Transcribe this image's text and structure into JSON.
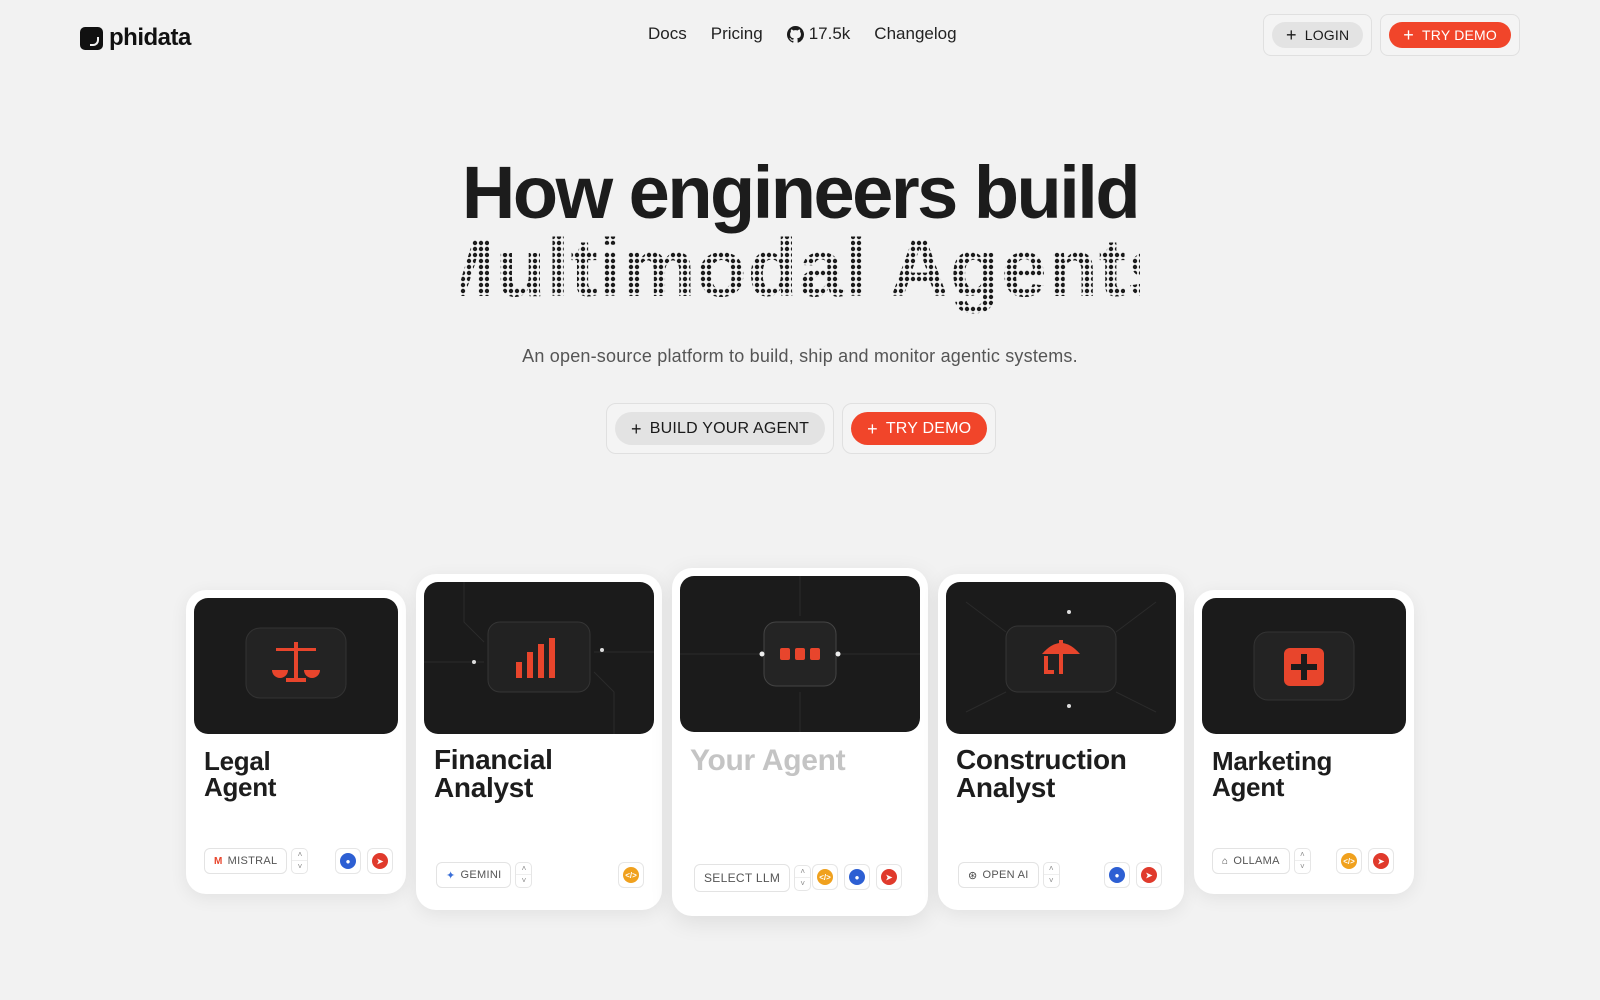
{
  "nav": {
    "logo": "phidata",
    "links": [
      "Docs",
      "Pricing",
      "17.5k",
      "Changelog"
    ],
    "login": "LOGIN",
    "try_demo": "TRY DEMO"
  },
  "hero": {
    "title": "How engineers build",
    "subtitle_dotted": "Multimodal Agents",
    "description": "An open-source platform to build, ship and monitor agentic systems.",
    "build_button": "BUILD YOUR AGENT",
    "demo_button": "TRY DEMO"
  },
  "cards": [
    {
      "title_line1": "Legal",
      "title_line2": "Agent",
      "llm": "MISTRAL",
      "icon": "scales-icon"
    },
    {
      "title_line1": "Financial",
      "title_line2": "Analyst",
      "llm": "GEMINI",
      "icon": "bar-chart-icon"
    },
    {
      "title_line1": "Your Agent",
      "title_line2": "",
      "llm": "SELECT LLM",
      "icon": "chat-dots-icon"
    },
    {
      "title_line1": "Construction",
      "title_line2": "Analyst",
      "llm": "OPEN AI",
      "icon": "crane-icon"
    },
    {
      "title_line1": "Marketing",
      "title_line2": "Agent",
      "llm": "OLLAMA",
      "icon": "plus-square-icon"
    }
  ],
  "colors": {
    "accent": "#f1452a",
    "background": "#f2f2f2",
    "card_image": "#1b1b1b"
  }
}
